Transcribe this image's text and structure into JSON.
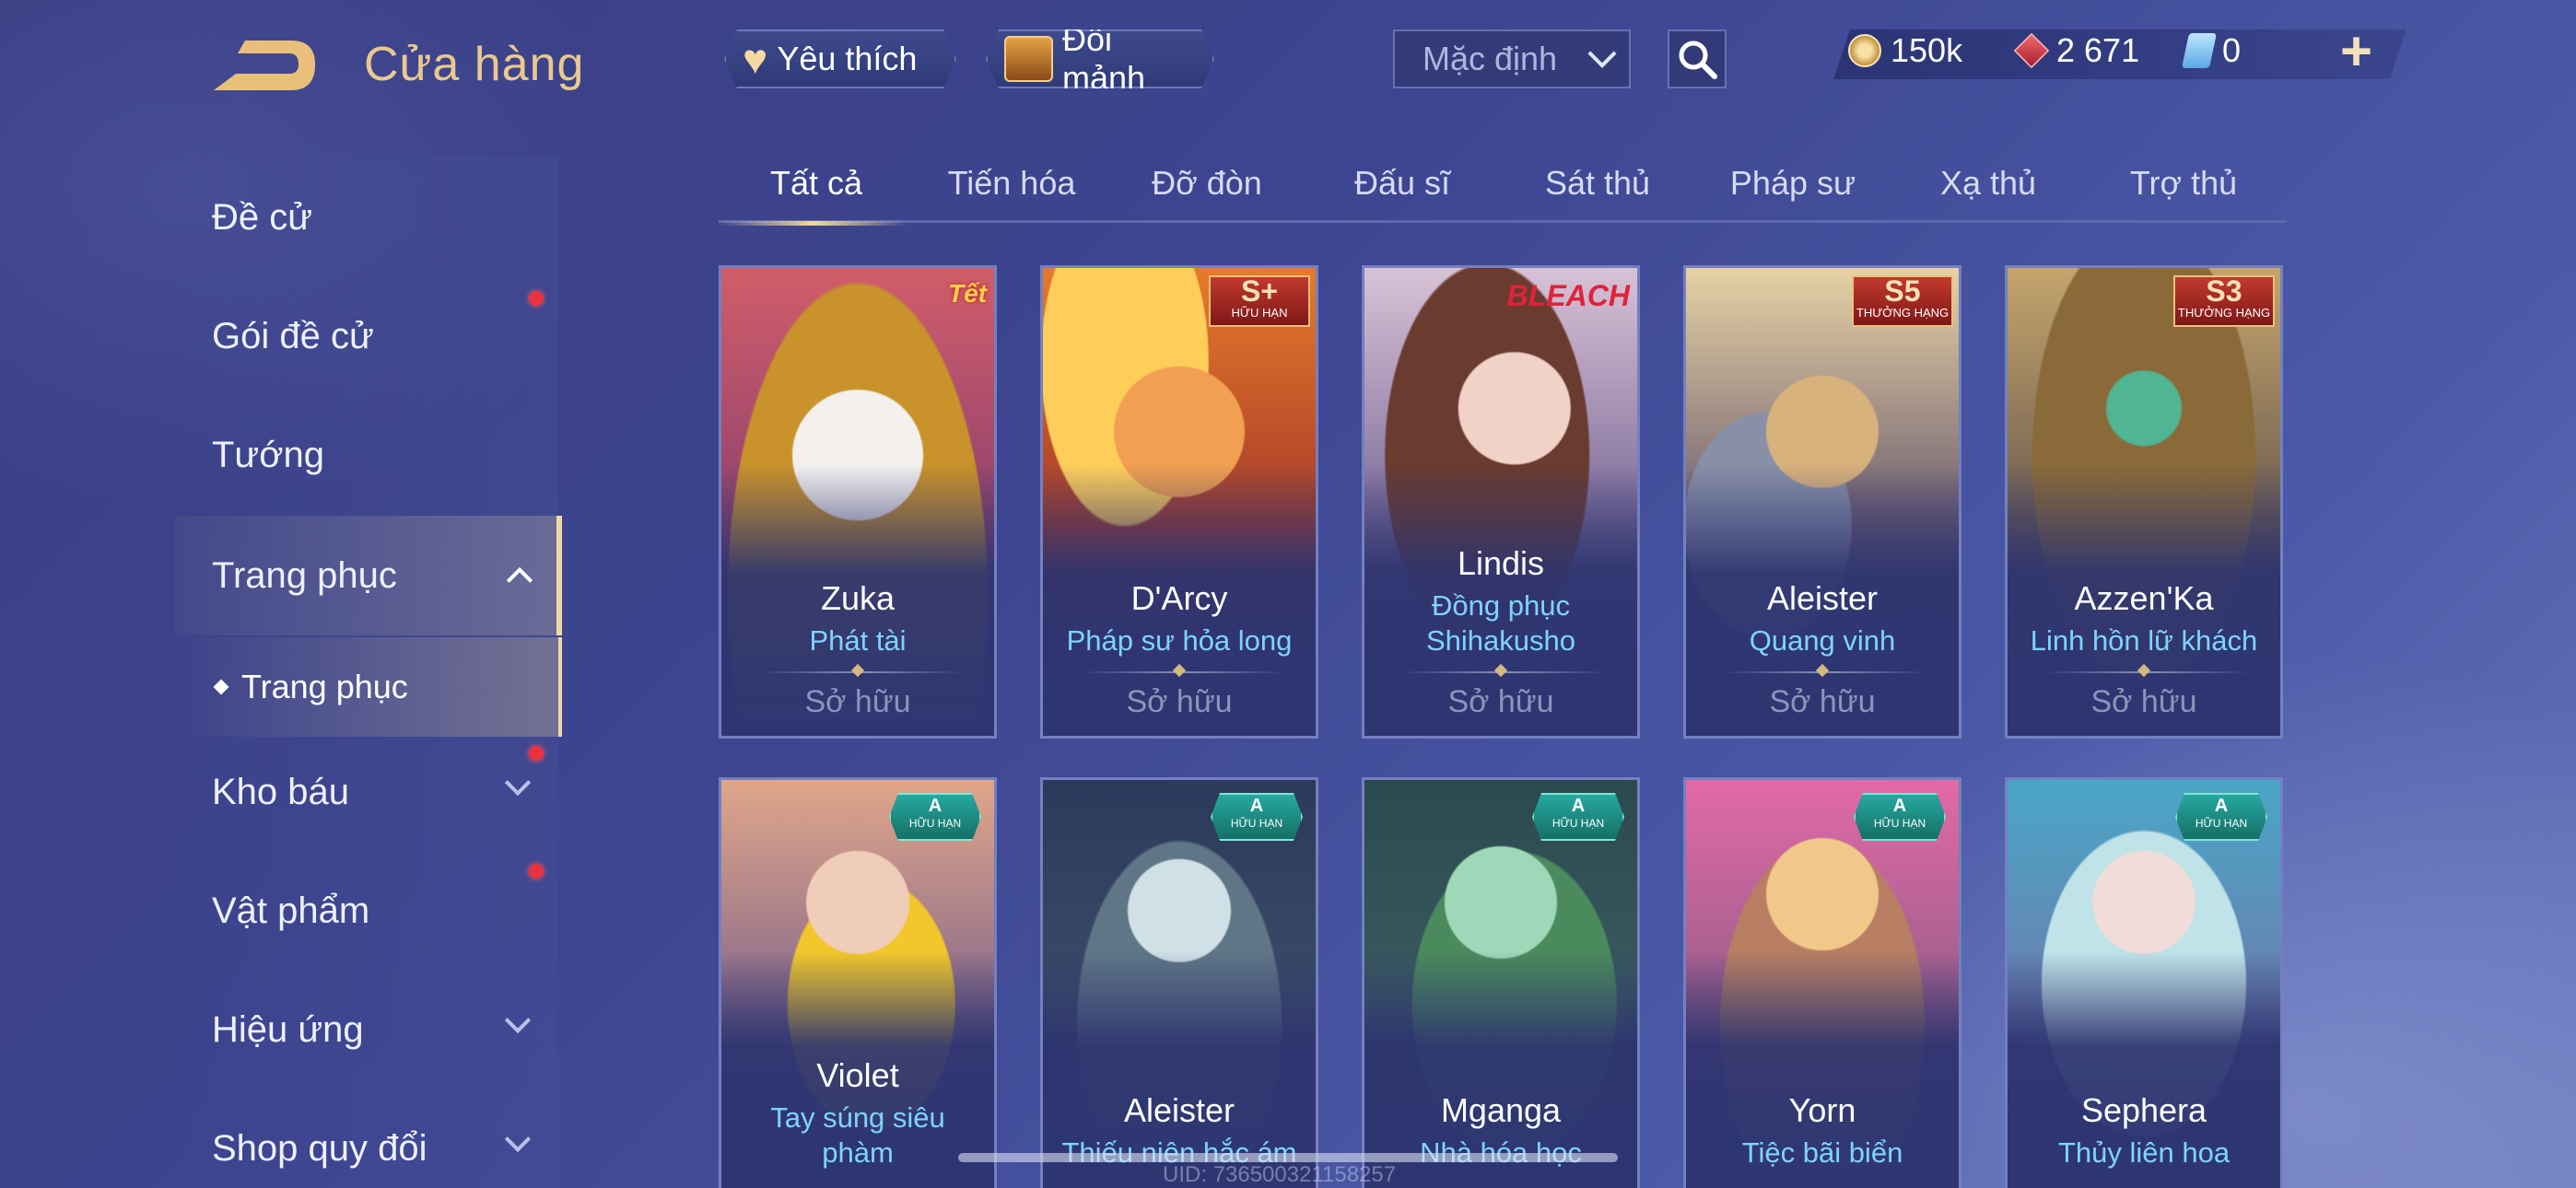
{
  "header": {
    "title": "Cửa hàng",
    "favorites_label": "Yêu thích",
    "fragments_label": "Đổi mảnh",
    "sort_selected": "Mặc định",
    "currency": {
      "gold": "150k",
      "gems": "2 671",
      "vouchers": "0"
    }
  },
  "sidebar": {
    "items": [
      {
        "label": "Đề cử"
      },
      {
        "label": "Gói đề cử"
      },
      {
        "label": "Tướng"
      },
      {
        "label": "Trang phục"
      },
      {
        "label": "Kho báu"
      },
      {
        "label": "Vật phẩm"
      },
      {
        "label": "Hiệu ứng"
      },
      {
        "label": "Shop quy đổi"
      }
    ],
    "sub_item": "Trang phục"
  },
  "tabs": [
    "Tất cả",
    "Tiến hóa",
    "Đỡ đòn",
    "Đấu sĩ",
    "Sát thủ",
    "Pháp sư",
    "Xạ thủ",
    "Trợ thủ"
  ],
  "cards_row1": [
    {
      "hero": "Zuka",
      "skin": "Phát tài",
      "status": "Sở hữu",
      "badge": "Tết"
    },
    {
      "hero": "D'Arcy",
      "skin": "Pháp sư hỏa long",
      "status": "Sở hữu",
      "badge_big": "S+",
      "badge_small": "HỮU HẠN"
    },
    {
      "hero": "Lindis",
      "skin_line1": "Đồng phục",
      "skin_line2": "Shihakusho",
      "status": "Sở hữu",
      "badge": "BLEACH"
    },
    {
      "hero": "Aleister",
      "skin": "Quang vinh",
      "status": "Sở hữu",
      "badge_big": "S5",
      "badge_small": "THƯỞNG HẠNG"
    },
    {
      "hero": "Azzen'Ka",
      "skin": "Linh hồn lữ khách",
      "status": "Sở hữu",
      "badge_big": "S3",
      "badge_small": "THƯỞNG HẠNG"
    }
  ],
  "cards_row2": [
    {
      "hero": "Violet",
      "skin_line1": "Tay súng siêu",
      "skin_line2": "phàm",
      "badge_big": "A",
      "badge_small": "HỮU HẠN"
    },
    {
      "hero": "Aleister",
      "skin": "Thiếu niên hắc ám",
      "badge_big": "A",
      "badge_small": "HỮU HẠN"
    },
    {
      "hero": "Mganga",
      "skin": "Nhà hóa học",
      "badge_big": "A",
      "badge_small": "HỮU HẠN"
    },
    {
      "hero": "Yorn",
      "skin": "Tiệc bãi biển",
      "badge_big": "A",
      "badge_small": "HỮU HẠN"
    },
    {
      "hero": "Sephera",
      "skin": "Thủy liên hoa",
      "badge_big": "A",
      "badge_small": "HỮU HẠN"
    }
  ],
  "footer": {
    "uid": "UID: 736500321158257"
  }
}
